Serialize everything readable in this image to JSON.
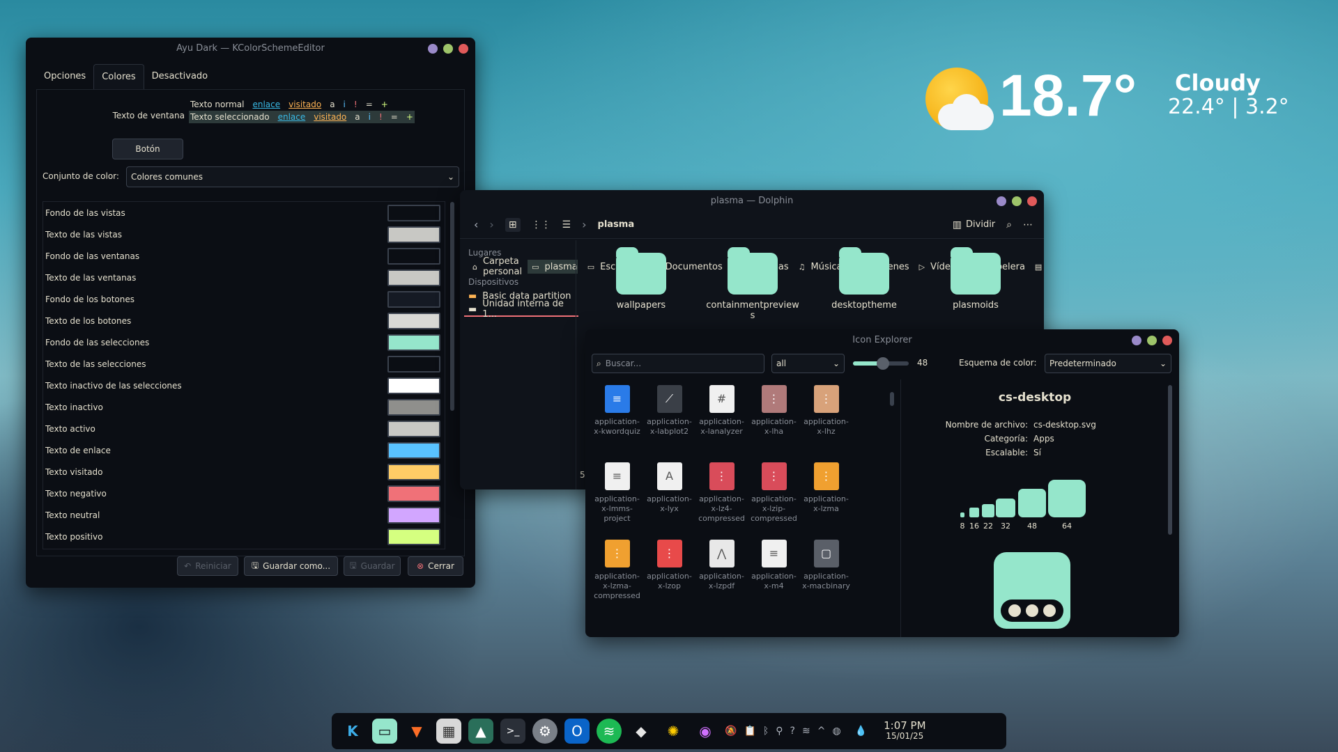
{
  "weather": {
    "temp": "18.7°",
    "condition": "Cloudy",
    "range": "22.4° | 3.2°"
  },
  "kcolor": {
    "title": "Ayu Dark — KColorSchemeEditor",
    "tabs": [
      "Opciones",
      "Colores",
      "Desactivado"
    ],
    "preview_label": "Texto de ventana",
    "normal_line": {
      "normal": "Texto normal",
      "link": "enlace",
      "visited": "visitado",
      "a": "a",
      "i": "i",
      "excl": "!",
      "eq": "=",
      "plus": "+"
    },
    "selected_line": {
      "normal": "Texto seleccionado",
      "link": "enlace",
      "visited": "visitado",
      "a": "a",
      "i": "i",
      "excl": "!",
      "eq": "=",
      "plus": "+"
    },
    "button_label": "Botón",
    "set_label": "Conjunto de color:",
    "set_value": "Colores comunes",
    "roles": [
      {
        "label": "Fondo de las vistas",
        "color": "#0b0e14"
      },
      {
        "label": "Texto de las vistas",
        "color": "#c8c8c4"
      },
      {
        "label": "Fondo de las ventanas",
        "color": "#0b0e14"
      },
      {
        "label": "Texto de las ventanas",
        "color": "#c8c8c4"
      },
      {
        "label": "Fondo de los botones",
        "color": "#151a24"
      },
      {
        "label": "Texto de los botones",
        "color": "#d8d8d4"
      },
      {
        "label": "Fondo de las selecciones",
        "color": "#95e6cb"
      },
      {
        "label": "Texto de las selecciones",
        "color": "#0b0e14"
      },
      {
        "label": "Texto inactivo de las selecciones",
        "color": "#ffffff"
      },
      {
        "label": "Texto inactivo",
        "color": "#8f8f8c"
      },
      {
        "label": "Texto activo",
        "color": "#c8c8c4"
      },
      {
        "label": "Texto de enlace",
        "color": "#59c2ff"
      },
      {
        "label": "Texto visitado",
        "color": "#ffcc66"
      },
      {
        "label": "Texto negativo",
        "color": "#f07178"
      },
      {
        "label": "Texto neutral",
        "color": "#d2a6ff"
      },
      {
        "label": "Texto positivo",
        "color": "#d5ff80"
      }
    ],
    "buttons": {
      "reset": "Reiniciar",
      "save_as": "Guardar como...",
      "save": "Guardar",
      "close": "Cerrar"
    }
  },
  "dolphin": {
    "title": "plasma — Dolphin",
    "breadcrumb": "plasma",
    "split": "Dividir",
    "places_header": "Lugares",
    "places": [
      "Carpeta personal",
      "plasma",
      "Escritorio",
      "Documentos",
      "Descargas",
      "Música",
      "Imágenes",
      "Vídeos",
      "Papelera",
      "icons"
    ],
    "devices_header": "Dispositivos",
    "devices": [
      "Basic data partition",
      "Unidad interna de 1..."
    ],
    "folders": [
      "wallpapers",
      "containmentpreview\ns",
      "desktoptheme",
      "plasmoids"
    ],
    "status": "5"
  },
  "iconexp": {
    "title": "Icon Explorer",
    "search_placeholder": "Buscar...",
    "filter": "all",
    "size": "48",
    "scheme_label": "Esquema de color:",
    "scheme_value": "Predeterminado",
    "icons": [
      {
        "name": "application-\nx-kwordquiz",
        "bg": "#2a7be8",
        "glyph": "≡"
      },
      {
        "name": "application-\nx-labplot2",
        "bg": "#3a3f47",
        "glyph": "⟋"
      },
      {
        "name": "application-\nx-lanalyzer",
        "bg": "#f0f0f0",
        "glyph": "#"
      },
      {
        "name": "application-\nx-lha",
        "bg": "#b07a7a",
        "glyph": "⋮"
      },
      {
        "name": "application-\nx-lhz",
        "bg": "#d8a27a",
        "glyph": "⋮"
      },
      {
        "name": "application-\nx-lmms-\nproject",
        "bg": "#f0f0f0",
        "glyph": "≡"
      },
      {
        "name": "application-\nx-lyx",
        "bg": "#f0f0f0",
        "glyph": "A"
      },
      {
        "name": "application-\nx-lz4-\ncompressed",
        "bg": "#d94c5a",
        "glyph": "⋮"
      },
      {
        "name": "application-\nx-lzip-\ncompressed",
        "bg": "#d94c5a",
        "glyph": "⋮"
      },
      {
        "name": "application-\nx-lzma",
        "bg": "#f0a030",
        "glyph": "⋮"
      },
      {
        "name": "application-\nx-lzma-\ncompressed",
        "bg": "#f0a030",
        "glyph": "⋮"
      },
      {
        "name": "application-\nx-lzop",
        "bg": "#e84a4a",
        "glyph": "⋮"
      },
      {
        "name": "application-\nx-lzpdf",
        "bg": "#e8e8e8",
        "glyph": "⋀"
      },
      {
        "name": "application-\nx-m4",
        "bg": "#f0f0f0",
        "glyph": "≡"
      },
      {
        "name": "application-\nx-macbinary",
        "bg": "#5a5f68",
        "glyph": "▢"
      }
    ],
    "detail": {
      "name": "cs-desktop",
      "file_label": "Nombre de archivo:",
      "file_value": "cs-desktop.svg",
      "cat_label": "Categoría:",
      "cat_value": "Apps",
      "scal_label": "Escalable:",
      "scal_value": "Sí",
      "sizes": [
        "8",
        "16",
        "22",
        "32",
        "48",
        "64"
      ]
    }
  },
  "dock": {
    "time": "1:07 PM",
    "date": "15/01/25"
  }
}
